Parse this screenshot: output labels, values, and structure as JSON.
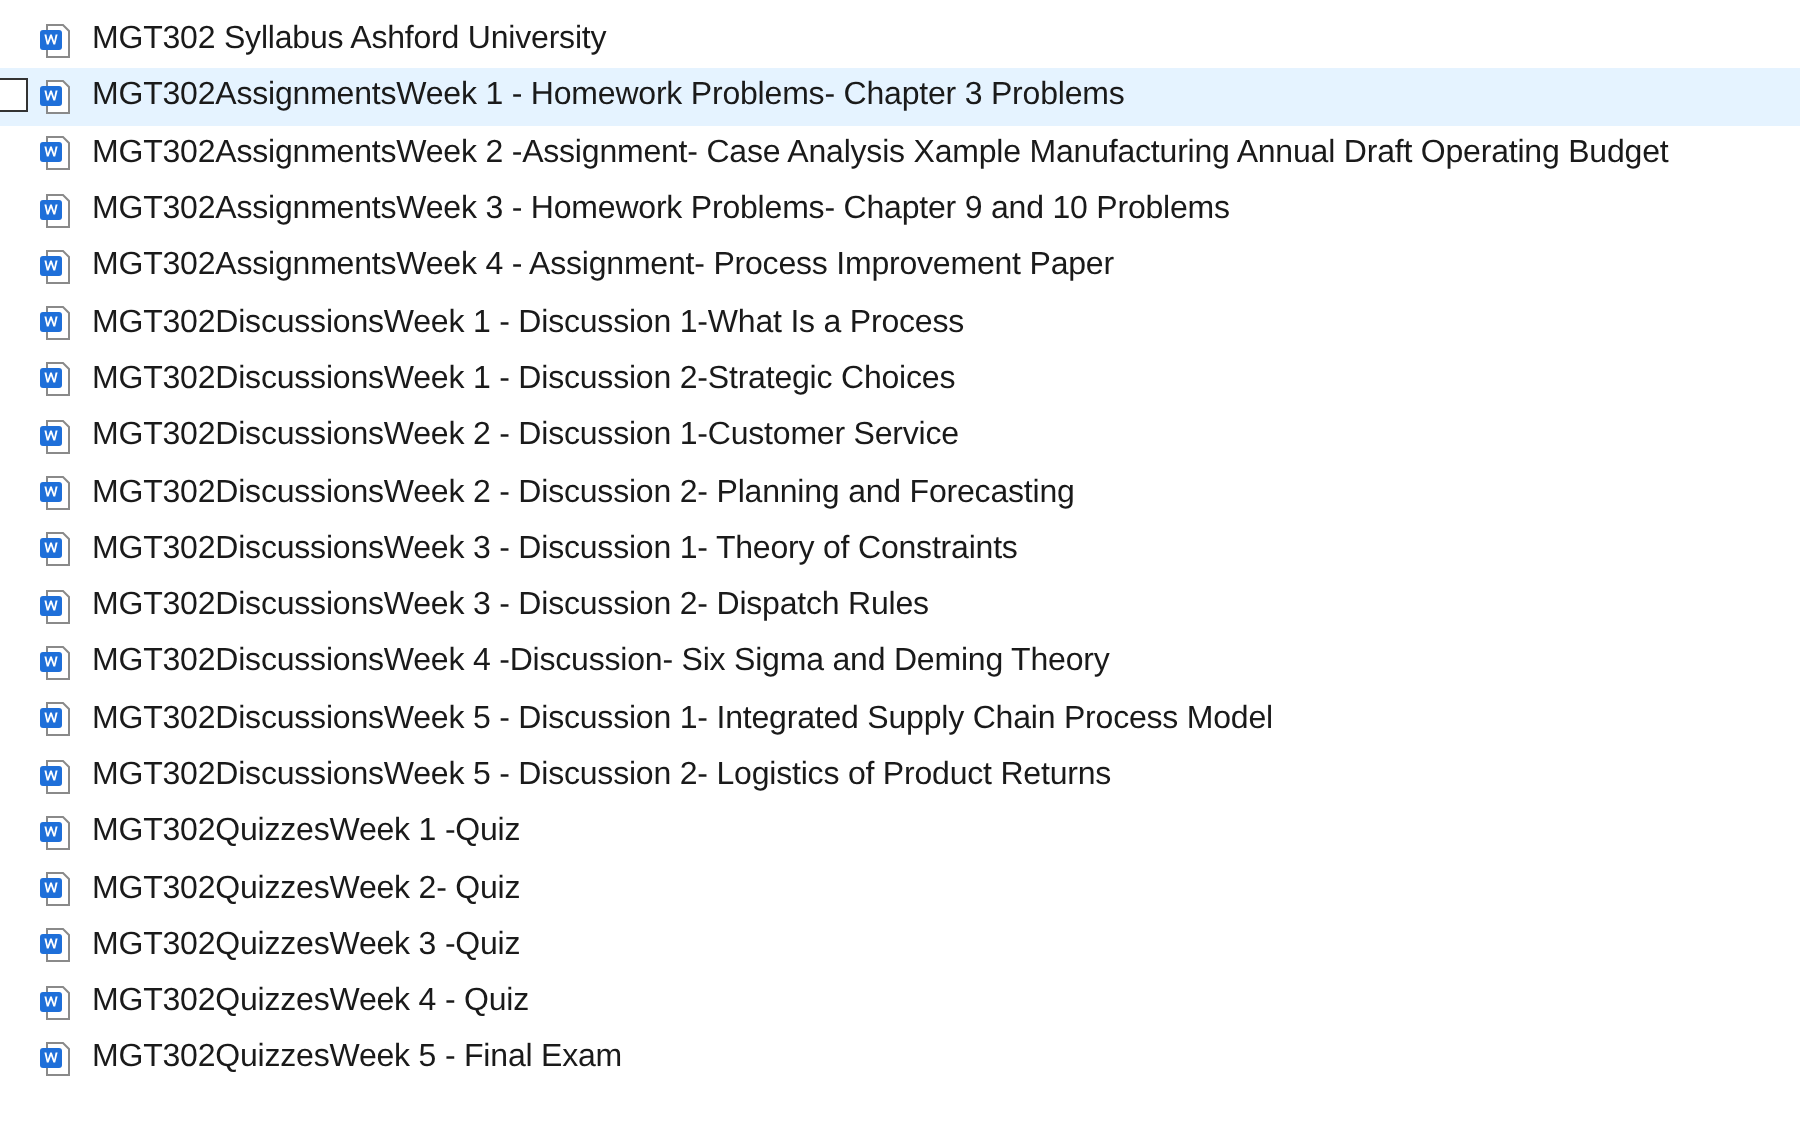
{
  "files": [
    {
      "name": "MGT302 Syllabus Ashford University",
      "hovered": false
    },
    {
      "name": "MGT302AssignmentsWeek 1 - Homework Problems- Chapter 3 Problems",
      "hovered": true
    },
    {
      "name": "MGT302AssignmentsWeek 2 -Assignment- Case Analysis Xample Manufacturing Annual Draft Operating Budget",
      "hovered": false
    },
    {
      "name": "MGT302AssignmentsWeek 3 - Homework Problems- Chapter 9 and 10 Problems",
      "hovered": false
    },
    {
      "name": "MGT302AssignmentsWeek 4 - Assignment- Process Improvement Paper",
      "hovered": false
    },
    {
      "name": "MGT302DiscussionsWeek 1 - Discussion 1-What Is a Process",
      "hovered": false
    },
    {
      "name": "MGT302DiscussionsWeek 1 - Discussion 2-Strategic Choices",
      "hovered": false
    },
    {
      "name": "MGT302DiscussionsWeek 2 - Discussion 1-Customer Service",
      "hovered": false
    },
    {
      "name": "MGT302DiscussionsWeek 2 - Discussion 2- Planning and Forecasting",
      "hovered": false
    },
    {
      "name": "MGT302DiscussionsWeek 3 - Discussion 1- Theory of Constraints",
      "hovered": false
    },
    {
      "name": "MGT302DiscussionsWeek 3 - Discussion 2- Dispatch Rules",
      "hovered": false
    },
    {
      "name": "MGT302DiscussionsWeek 4 -Discussion- Six Sigma and Deming Theory",
      "hovered": false
    },
    {
      "name": "MGT302DiscussionsWeek 5 - Discussion 1- Integrated Supply Chain Process Model",
      "hovered": false
    },
    {
      "name": "MGT302DiscussionsWeek 5 - Discussion 2- Logistics of Product Returns",
      "hovered": false
    },
    {
      "name": "MGT302QuizzesWeek 1 -Quiz",
      "hovered": false
    },
    {
      "name": "MGT302QuizzesWeek 2- Quiz",
      "hovered": false
    },
    {
      "name": "MGT302QuizzesWeek 3 -Quiz",
      "hovered": false
    },
    {
      "name": "MGT302QuizzesWeek 4 - Quiz",
      "hovered": false
    },
    {
      "name": "MGT302QuizzesWeek 5 - Final Exam",
      "hovered": false
    }
  ]
}
